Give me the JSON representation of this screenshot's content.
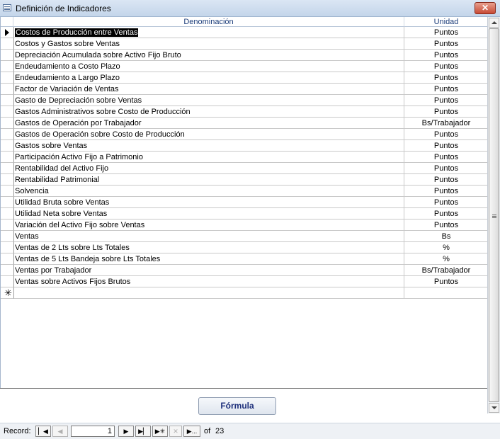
{
  "window": {
    "title": "Definición de Indicadores",
    "close_glyph": "✕"
  },
  "grid": {
    "headers": {
      "denominacion": "Denominación",
      "unidad": "Unidad"
    },
    "rows": [
      {
        "denominacion": "Costos de Producción entre Ventas",
        "unidad": "Puntos"
      },
      {
        "denominacion": "Costos y Gastos sobre Ventas",
        "unidad": "Puntos"
      },
      {
        "denominacion": "Depreciación Acumulada sobre Activo Fijo Bruto",
        "unidad": "Puntos"
      },
      {
        "denominacion": "Endeudamiento a Costo Plazo",
        "unidad": "Puntos"
      },
      {
        "denominacion": "Endeudamiento a Largo Plazo",
        "unidad": "Puntos"
      },
      {
        "denominacion": "Factor de Variación de Ventas",
        "unidad": "Puntos"
      },
      {
        "denominacion": "Gasto de Depreciación sobre Ventas",
        "unidad": "Puntos"
      },
      {
        "denominacion": "Gastos Administrativos sobre Costo de Producción",
        "unidad": "Puntos"
      },
      {
        "denominacion": "Gastos de Operación por Trabajador",
        "unidad": "Bs/Trabajador"
      },
      {
        "denominacion": "Gastos de Operación sobre Costo de Producción",
        "unidad": "Puntos"
      },
      {
        "denominacion": "Gastos sobre Ventas",
        "unidad": "Puntos"
      },
      {
        "denominacion": "Participación Activo Fijo a Patrimonio",
        "unidad": "Puntos"
      },
      {
        "denominacion": "Rentabilidad del Activo Fijo",
        "unidad": "Puntos"
      },
      {
        "denominacion": "Rentabilidad Patrimonial",
        "unidad": "Puntos"
      },
      {
        "denominacion": "Solvencia",
        "unidad": "Puntos"
      },
      {
        "denominacion": "Utilidad Bruta sobre Ventas",
        "unidad": "Puntos"
      },
      {
        "denominacion": "Utilidad Neta sobre Ventas",
        "unidad": "Puntos"
      },
      {
        "denominacion": "Variación del Activo Fijo sobre Ventas",
        "unidad": "Puntos"
      },
      {
        "denominacion": "Ventas",
        "unidad": "Bs"
      },
      {
        "denominacion": "Ventas de 2 Lts sobre Lts Totales",
        "unidad": "%"
      },
      {
        "denominacion": "Ventas de 5 Lts Bandeja sobre Lts Totales",
        "unidad": "%"
      },
      {
        "denominacion": "Ventas por Trabajador",
        "unidad": "Bs/Trabajador"
      },
      {
        "denominacion": "Ventas sobre Activos Fijos Brutos",
        "unidad": "Puntos"
      }
    ],
    "new_record_glyph": "✳"
  },
  "buttons": {
    "formula": "Fórmula"
  },
  "navigation": {
    "label": "Record:",
    "current": "1",
    "of_label": "of",
    "total": "23",
    "icons": {
      "first": "▏◀",
      "prev": "◀",
      "next": "▶",
      "last": "▶▏",
      "new": "▶✳",
      "clear": "✕",
      "search": "▶..."
    }
  }
}
